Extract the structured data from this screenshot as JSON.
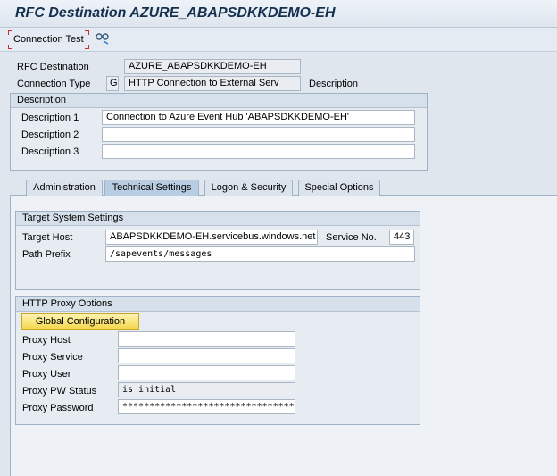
{
  "window": {
    "title": "RFC Destination AZURE_ABAPSDKKDEMO-EH"
  },
  "toolbar": {
    "connection_test_label": "Connection Test"
  },
  "header": {
    "rfc_destination_label": "RFC Destination",
    "rfc_destination_value": "AZURE_ABAPSDKKDEMO-EH",
    "connection_type_label": "Connection Type",
    "connection_type_code": "G",
    "connection_type_value": "HTTP Connection to External Serv",
    "connection_type_desc_label": "Description"
  },
  "description": {
    "title": "Description",
    "rows": [
      {
        "label": "Description 1",
        "value": "Connection to Azure Event Hub 'ABAPSDKKDEMO-EH'"
      },
      {
        "label": "Description 2",
        "value": ""
      },
      {
        "label": "Description 3",
        "value": ""
      }
    ]
  },
  "tabs": [
    {
      "label": "Administration",
      "active": false
    },
    {
      "label": "Technical Settings",
      "active": true
    },
    {
      "label": "Logon & Security",
      "active": false
    },
    {
      "label": "Special Options",
      "active": false
    }
  ],
  "target": {
    "title": "Target System Settings",
    "host_label": "Target Host",
    "host_value": "ABAPSDKKDEMO-EH.servicebus.windows.net",
    "service_label": "Service No.",
    "service_value": "443",
    "path_label": "Path Prefix",
    "path_value": "/sapevents/messages"
  },
  "proxy": {
    "title": "HTTP Proxy Options",
    "global_config_label": "Global Configuration",
    "host_label": "Proxy Host",
    "host_value": "",
    "service_label": "Proxy Service",
    "service_value": "",
    "user_label": "Proxy User",
    "user_value": "",
    "pw_status_label": "Proxy PW Status",
    "pw_status_value": "is initial",
    "password_label": "Proxy Password",
    "password_value": "************************************"
  },
  "colors": {
    "accent": "#15304f",
    "active_tab": "#b8cde2",
    "button_yellow": "#f5d84e",
    "marker_red": "#d8292f"
  },
  "icons": {
    "glasses": "glasses-icon"
  }
}
